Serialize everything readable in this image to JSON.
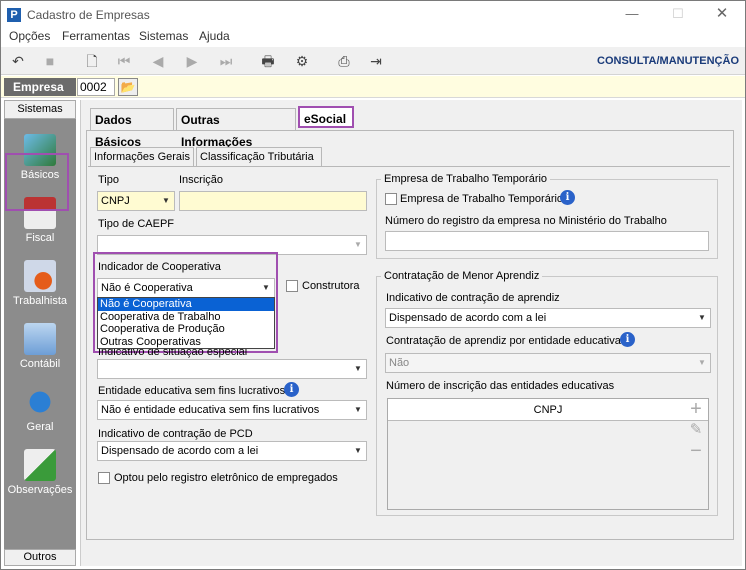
{
  "window": {
    "title": "Cadastro de Empresas",
    "app_icon": "P"
  },
  "menu": [
    "Opções",
    "Ferramentas",
    "Sistemas",
    "Ajuda"
  ],
  "toolbar": {
    "mode_label": "CONSULTA/MANUTENÇÃO"
  },
  "empresa": {
    "label": "Empresa",
    "code": "0002"
  },
  "sidebar": {
    "header": "Sistemas",
    "footer": "Outros",
    "items": [
      {
        "label": "Básicos"
      },
      {
        "label": "Fiscal"
      },
      {
        "label": "Trabalhista"
      },
      {
        "label": "Contábil"
      },
      {
        "label": "Geral"
      },
      {
        "label": "Observações"
      }
    ]
  },
  "tabs": [
    "Dados Básicos",
    "Outras Informações",
    "eSocial"
  ],
  "subtabs": [
    "Informações Gerais",
    "Classificação Tributária"
  ],
  "form": {
    "tipo_label": "Tipo",
    "tipo_value": "CNPJ",
    "inscricao_label": "Inscrição",
    "inscricao_value": "",
    "caepf_label": "Tipo de CAEPF",
    "caepf_value": "",
    "cooperativa_label": "Indicador de Cooperativa",
    "cooperativa_value": "Não é Cooperativa",
    "cooperativa_options": [
      "Não é Cooperativa",
      "Cooperativa de Trabalho",
      "Cooperativa de Produção",
      "Outras Cooperativas"
    ],
    "construtora_label": "Construtora",
    "situacao_label": "Indicativo de situação especial",
    "situacao_value": "",
    "entidade_label": "Entidade educativa sem fins lucrativos",
    "entidade_value": "Não é entidade educativa sem fins lucrativos",
    "pcd_label": "Indicativo de contração de PCD",
    "pcd_value": "Dispensado de acordo com a lei",
    "optou_label": "Optou pelo registro eletrônico de empregados"
  },
  "trabalho_temp": {
    "group_title": "Empresa de Trabalho Temporário",
    "check_label": "Empresa de Trabalho Temporário",
    "registro_label": "Número do registro da empresa no Ministério do Trabalho",
    "registro_value": ""
  },
  "aprendiz": {
    "group_title": "Contratação de Menor Aprendiz",
    "indicativo_label": "Indicativo de contração de aprendiz",
    "indicativo_value": "Dispensado de acordo com a lei",
    "entidade_label": "Contratação de aprendiz por entidade educativa",
    "entidade_value": "Não",
    "inscricao_label": "Número de inscrição das entidades educativas",
    "grid_header": "CNPJ"
  },
  "colors": {
    "highlight": "#a04fb0",
    "selection": "#0a62d4",
    "accent": "#1a3b7a"
  }
}
